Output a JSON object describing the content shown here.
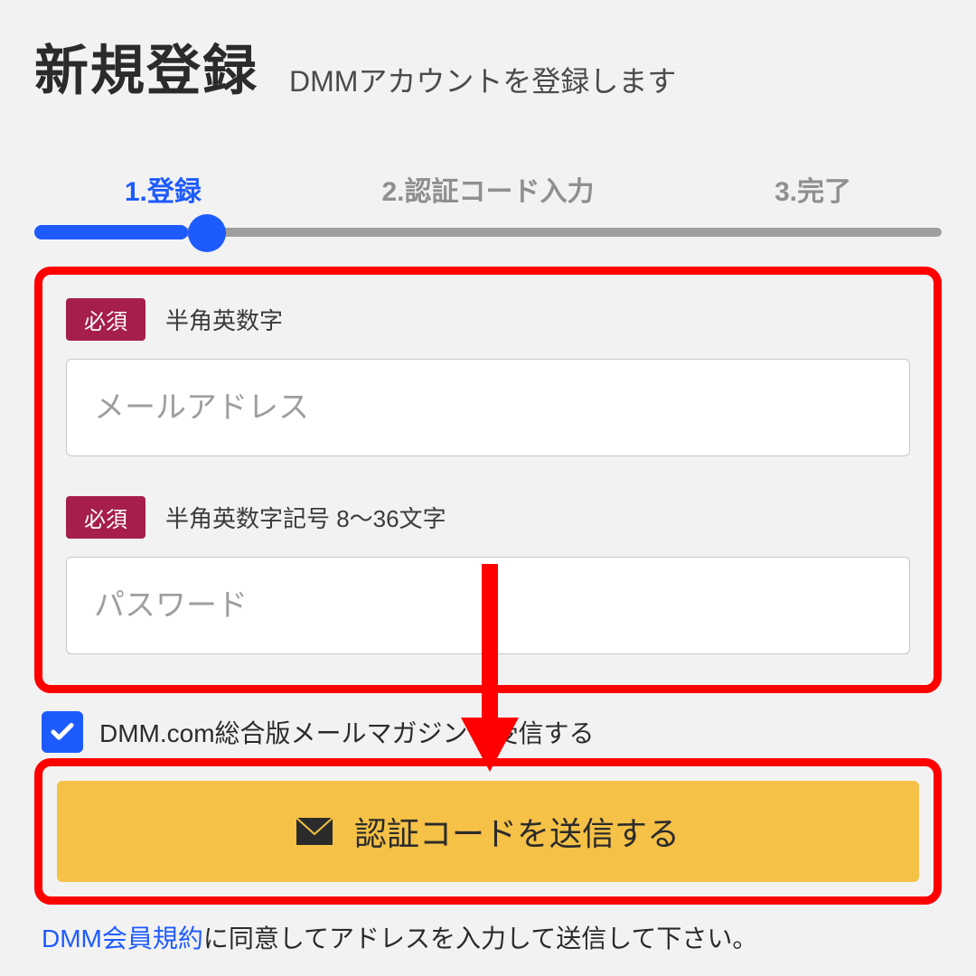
{
  "header": {
    "title": "新規登録",
    "subtitle": "DMMアカウントを登録します"
  },
  "steps": {
    "s1": "1.登録",
    "s2": "2.認証コード入力",
    "s3": "3.完了"
  },
  "form": {
    "required_label": "必須",
    "email_hint": "半角英数字",
    "email_placeholder": "メールアドレス",
    "password_hint": "半角英数字記号 8〜36文字",
    "password_placeholder": "パスワード"
  },
  "newsletter": {
    "label": "DMM.com総合版メールマガジンを受信する"
  },
  "submit": {
    "label": "認証コードを送信する"
  },
  "terms": {
    "link": "DMM会員規約",
    "tail": "に同意してアドレスを入力して送信して下さい。"
  }
}
